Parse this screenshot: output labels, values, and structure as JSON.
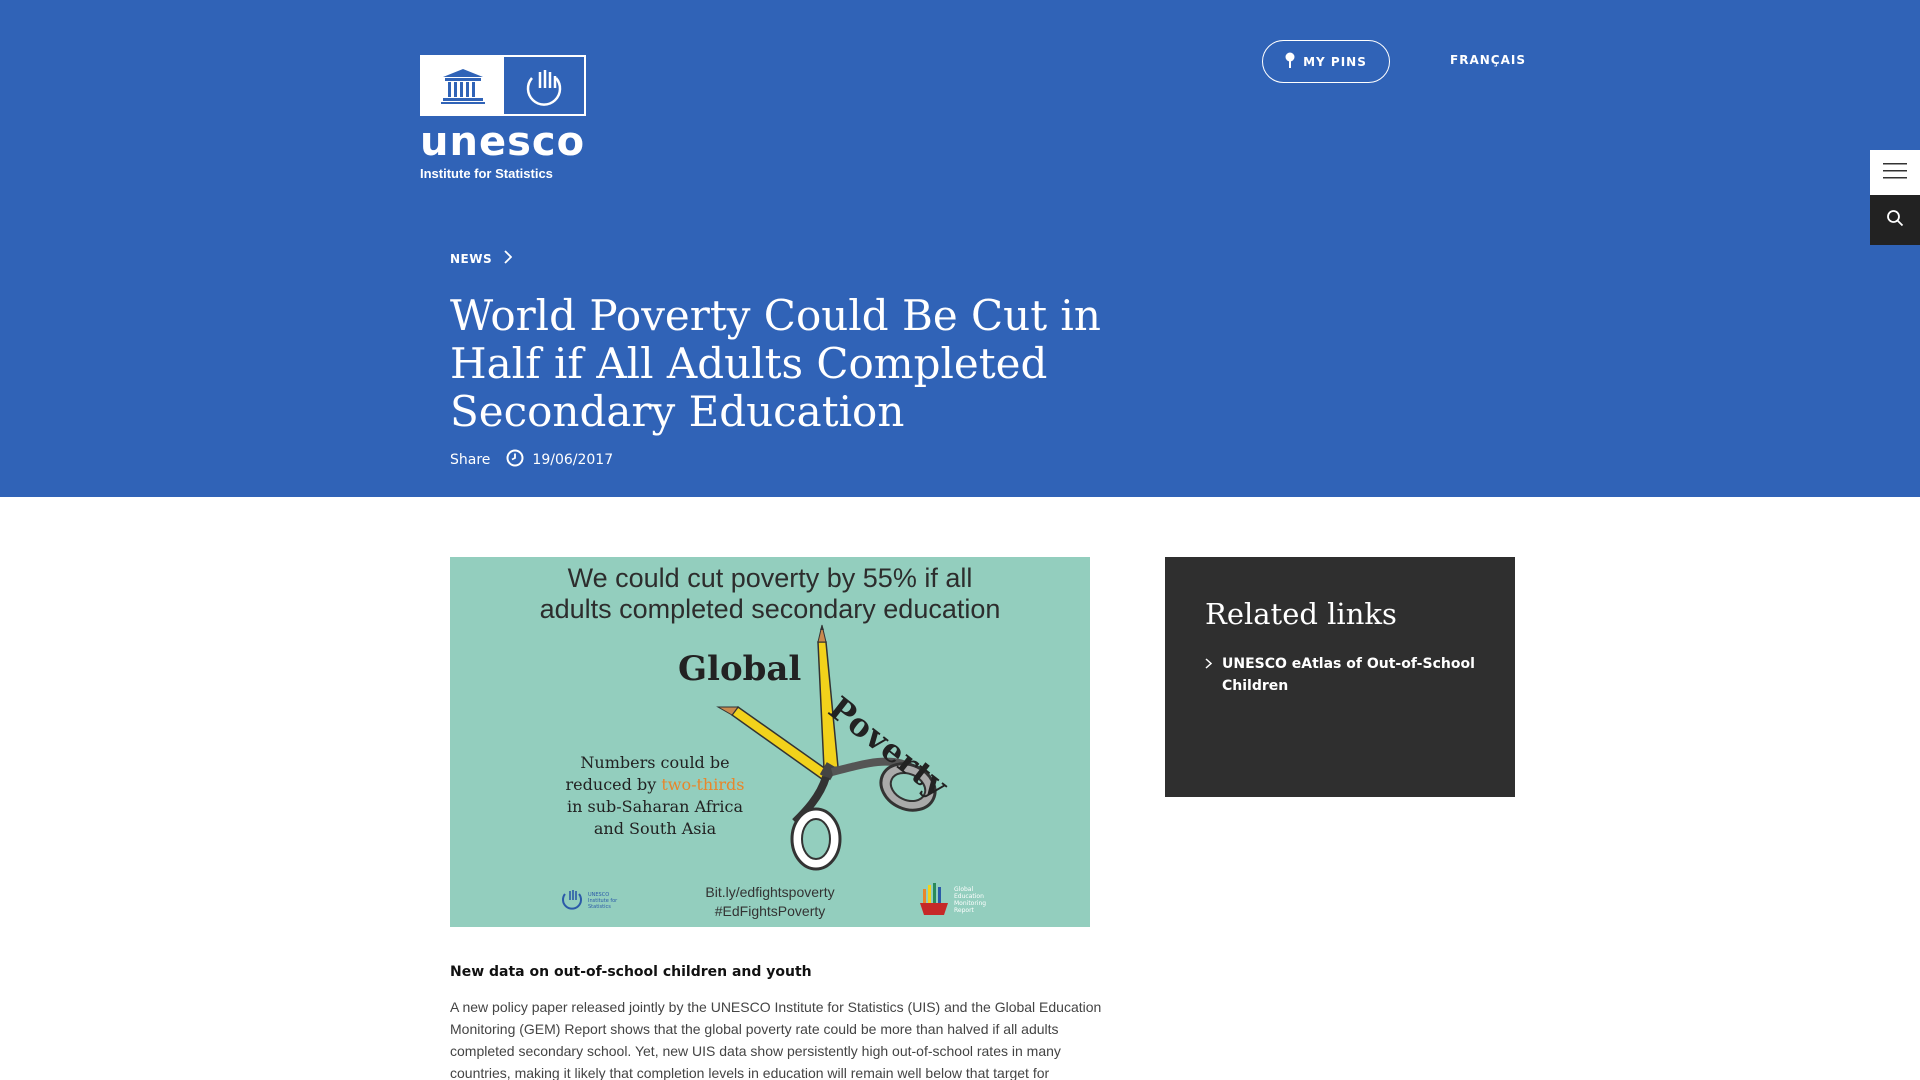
{
  "header": {
    "logo_word": "unesco",
    "logo_sub": "Institute for Statistics",
    "my_pins_label": "MY PINS",
    "language_label": "FRANÇAIS"
  },
  "icons": {
    "pin": "map-pin-icon",
    "menu": "hamburger-menu-icon",
    "search": "search-icon",
    "clock": "clock-icon",
    "chevron": "chevron-right-icon"
  },
  "breadcrumb": {
    "label": "NEWS"
  },
  "article": {
    "title": "World Poverty Could Be Cut in Half if All Adults Completed Secondary Education",
    "share_label": "Share",
    "date": "19/06/2017",
    "image": {
      "headline_line1": "We could cut poverty by 55% if all",
      "headline_line2": "adults completed secondary education",
      "word_global": "Global",
      "word_poverty": "Poverty",
      "numbers_line1": "Numbers could be",
      "numbers_line2_prefix": "reduced by ",
      "numbers_highlight": "two-thirds",
      "numbers_line3": "in sub-Saharan Africa",
      "numbers_line4": "and South Asia",
      "link_line1": "Bit.ly/edfightspoverty",
      "link_line2": "#EdFightsPoverty",
      "uis_logo_text": "UNESCO Institute for Statistics",
      "gem_logo_text": "Global Education Monitoring Report"
    },
    "lead": "New data on out-of-school children and youth",
    "body": "A new policy paper released jointly by the UNESCO Institute for Statistics (UIS) and the Global Education Monitoring (GEM) Report shows that the global poverty rate could be more than halved if all adults completed secondary school. Yet, new UIS data show persistently high out-of-school rates in many countries, making it likely that completion levels in education will remain well below that target for"
  },
  "related": {
    "title": "Related links",
    "items": [
      {
        "label": "UNESCO eAtlas of Out-of-School Children"
      }
    ]
  },
  "colors": {
    "hero_blue": "#3063b7",
    "related_bg": "#2f2f2f",
    "image_bg": "#93cebe",
    "highlight_orange": "#e8862b"
  }
}
